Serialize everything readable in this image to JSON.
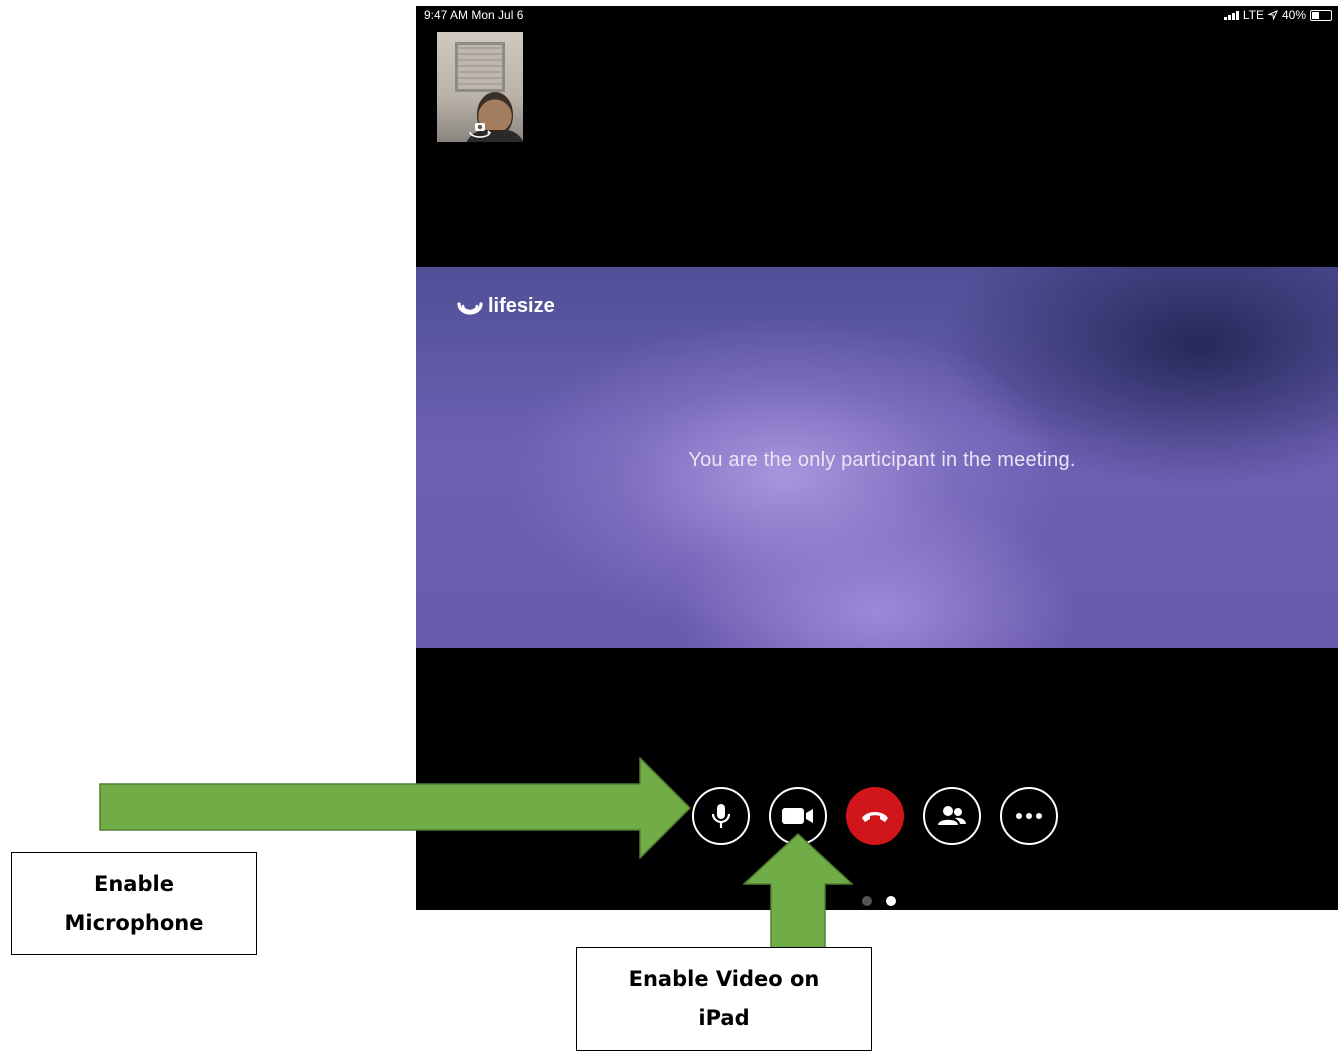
{
  "status_bar": {
    "time": "9:47 AM   Mon Jul 6",
    "network": "LTE",
    "battery": "40%"
  },
  "brand": {
    "name": "lifesize"
  },
  "stage": {
    "message": "You are the only participant in the meeting."
  },
  "controls": [
    {
      "name": "microphone",
      "icon": "microphone-icon"
    },
    {
      "name": "video",
      "icon": "video-camera-icon"
    },
    {
      "name": "end-call",
      "icon": "phone-hangup-icon",
      "color": "#d0161b"
    },
    {
      "name": "participants",
      "icon": "participants-icon"
    },
    {
      "name": "more",
      "icon": "more-icon"
    }
  ],
  "pager": {
    "pages": 2,
    "active": 2
  },
  "annotations": {
    "arrow_color": "#70ad47",
    "microphone_label": "Enable Microphone",
    "microphone_label_line1": "Enable",
    "microphone_label_line2": "Microphone",
    "video_label_line1": "Enable Video on",
    "video_label_line2": "iPad"
  }
}
